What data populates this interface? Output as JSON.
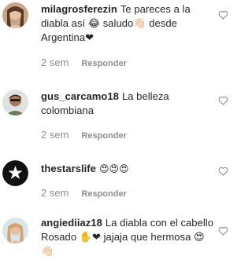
{
  "comments": [
    {
      "username": "milagrosferezin",
      "text": "Te pareces a la diabla así 😂 saludo👋🏻 desde Argentina❤",
      "time": "2 sem",
      "reply_label": "Responder",
      "avatar_icon": "user-photo-avatar"
    },
    {
      "username": "gus_carcamo18",
      "text": "La belleza colombiana",
      "time": "2 sem",
      "reply_label": "Responder",
      "avatar_icon": "user-photo-avatar"
    },
    {
      "username": "thestarslife",
      "text": "😍😍😍",
      "time": "2 sem",
      "reply_label": "Responder",
      "avatar_icon": "star-logo-avatar"
    },
    {
      "username": "angiediiaz18",
      "text": "La diabla con el cabello Rosado ✋❤ jajaja que hermosa 😍👋🏻",
      "time": "",
      "reply_label": "",
      "avatar_icon": "user-photo-avatar"
    }
  ],
  "icons": {
    "like": "heart-outline-icon"
  },
  "colors": {
    "text": "#262626",
    "secondary": "#8e8e8e"
  }
}
